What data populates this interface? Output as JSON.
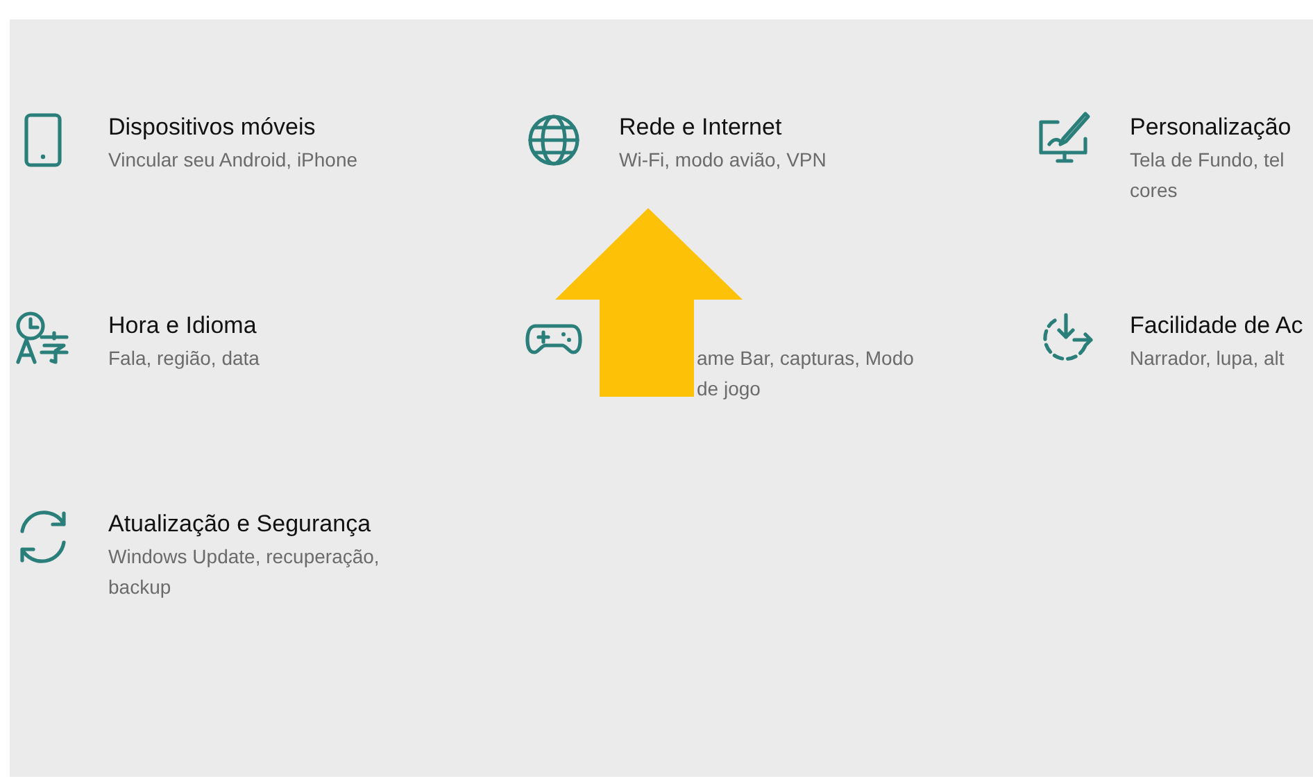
{
  "items": [
    {
      "kind": "phone",
      "title": "Dispositivos móveis",
      "subtitle_lines": [
        "Vincular seu Android, iPhone"
      ]
    },
    {
      "kind": "globe",
      "title": "Rede e Internet",
      "subtitle_lines": [
        "Wi-Fi, modo avião, VPN"
      ]
    },
    {
      "kind": "paint",
      "title": "Personalização",
      "subtitle_lines": [
        "Tela de Fundo, tel",
        "cores"
      ]
    },
    {
      "kind": "language",
      "title": "Hora e Idioma",
      "subtitle_lines": [
        "Fala, região, data"
      ]
    },
    {
      "kind": "gamepad",
      "subtitle_lines": [
        "ame Bar, capturas, Modo",
        "de jogo"
      ]
    },
    {
      "kind": "access",
      "title": "Facilidade de Ac",
      "subtitle_lines": [
        "Narrador, lupa, alt"
      ]
    },
    {
      "kind": "sync",
      "title": "Atualização e Segurança",
      "subtitle_lines": [
        "Windows Update, recuperação,",
        "backup"
      ]
    }
  ]
}
